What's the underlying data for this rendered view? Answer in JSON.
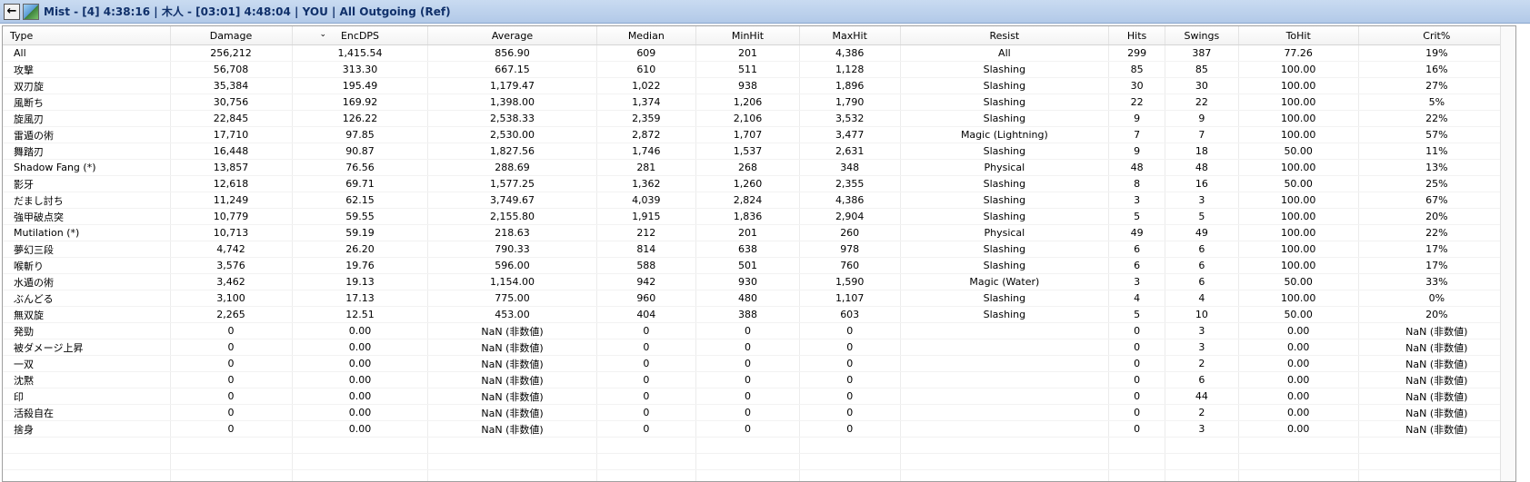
{
  "window": {
    "title": "Mist - [4] 4:38:16 | 木人 - [03:01] 4:48:04 | YOU | All Outgoing (Ref)",
    "back_icon": "←"
  },
  "table": {
    "columns": [
      "Type",
      "Damage",
      "EncDPS",
      "Average",
      "Median",
      "MinHit",
      "MaxHit",
      "Resist",
      "Hits",
      "Swings",
      "ToHit",
      "Crit%"
    ],
    "sorted_column": "EncDPS",
    "rows": [
      [
        "All",
        "256,212",
        "1,415.54",
        "856.90",
        "609",
        "201",
        "4,386",
        "All",
        "299",
        "387",
        "77.26",
        "19%"
      ],
      [
        "攻撃",
        "56,708",
        "313.30",
        "667.15",
        "610",
        "511",
        "1,128",
        "Slashing",
        "85",
        "85",
        "100.00",
        "16%"
      ],
      [
        "双刃旋",
        "35,384",
        "195.49",
        "1,179.47",
        "1,022",
        "938",
        "1,896",
        "Slashing",
        "30",
        "30",
        "100.00",
        "27%"
      ],
      [
        "風断ち",
        "30,756",
        "169.92",
        "1,398.00",
        "1,374",
        "1,206",
        "1,790",
        "Slashing",
        "22",
        "22",
        "100.00",
        "5%"
      ],
      [
        "旋風刃",
        "22,845",
        "126.22",
        "2,538.33",
        "2,359",
        "2,106",
        "3,532",
        "Slashing",
        "9",
        "9",
        "100.00",
        "22%"
      ],
      [
        "雷遁の術",
        "17,710",
        "97.85",
        "2,530.00",
        "2,872",
        "1,707",
        "3,477",
        "Magic (Lightning)",
        "7",
        "7",
        "100.00",
        "57%"
      ],
      [
        "舞踏刃",
        "16,448",
        "90.87",
        "1,827.56",
        "1,746",
        "1,537",
        "2,631",
        "Slashing",
        "9",
        "18",
        "50.00",
        "11%"
      ],
      [
        "Shadow Fang (*)",
        "13,857",
        "76.56",
        "288.69",
        "281",
        "268",
        "348",
        "Physical",
        "48",
        "48",
        "100.00",
        "13%"
      ],
      [
        "影牙",
        "12,618",
        "69.71",
        "1,577.25",
        "1,362",
        "1,260",
        "2,355",
        "Slashing",
        "8",
        "16",
        "50.00",
        "25%"
      ],
      [
        "だまし討ち",
        "11,249",
        "62.15",
        "3,749.67",
        "4,039",
        "2,824",
        "4,386",
        "Slashing",
        "3",
        "3",
        "100.00",
        "67%"
      ],
      [
        "強甲破点突",
        "10,779",
        "59.55",
        "2,155.80",
        "1,915",
        "1,836",
        "2,904",
        "Slashing",
        "5",
        "5",
        "100.00",
        "20%"
      ],
      [
        "Mutilation (*)",
        "10,713",
        "59.19",
        "218.63",
        "212",
        "201",
        "260",
        "Physical",
        "49",
        "49",
        "100.00",
        "22%"
      ],
      [
        "夢幻三段",
        "4,742",
        "26.20",
        "790.33",
        "814",
        "638",
        "978",
        "Slashing",
        "6",
        "6",
        "100.00",
        "17%"
      ],
      [
        "喉斬り",
        "3,576",
        "19.76",
        "596.00",
        "588",
        "501",
        "760",
        "Slashing",
        "6",
        "6",
        "100.00",
        "17%"
      ],
      [
        "水遁の術",
        "3,462",
        "19.13",
        "1,154.00",
        "942",
        "930",
        "1,590",
        "Magic (Water)",
        "3",
        "6",
        "50.00",
        "33%"
      ],
      [
        "ぶんどる",
        "3,100",
        "17.13",
        "775.00",
        "960",
        "480",
        "1,107",
        "Slashing",
        "4",
        "4",
        "100.00",
        "0%"
      ],
      [
        "無双旋",
        "2,265",
        "12.51",
        "453.00",
        "404",
        "388",
        "603",
        "Slashing",
        "5",
        "10",
        "50.00",
        "20%"
      ],
      [
        "発勁",
        "0",
        "0.00",
        "NaN (非数値)",
        "0",
        "0",
        "0",
        "",
        "0",
        "3",
        "0.00",
        "NaN (非数値)"
      ],
      [
        "被ダメージ上昇",
        "0",
        "0.00",
        "NaN (非数値)",
        "0",
        "0",
        "0",
        "",
        "0",
        "3",
        "0.00",
        "NaN (非数値)"
      ],
      [
        "一双",
        "0",
        "0.00",
        "NaN (非数値)",
        "0",
        "0",
        "0",
        "",
        "0",
        "2",
        "0.00",
        "NaN (非数値)"
      ],
      [
        "沈黙",
        "0",
        "0.00",
        "NaN (非数値)",
        "0",
        "0",
        "0",
        "",
        "0",
        "6",
        "0.00",
        "NaN (非数値)"
      ],
      [
        "印",
        "0",
        "0.00",
        "NaN (非数値)",
        "0",
        "0",
        "0",
        "",
        "0",
        "44",
        "0.00",
        "NaN (非数値)"
      ],
      [
        "活殺自在",
        "0",
        "0.00",
        "NaN (非数値)",
        "0",
        "0",
        "0",
        "",
        "0",
        "2",
        "0.00",
        "NaN (非数値)"
      ],
      [
        "捨身",
        "0",
        "0.00",
        "NaN (非数値)",
        "0",
        "0",
        "0",
        "",
        "0",
        "3",
        "0.00",
        "NaN (非数値)"
      ]
    ]
  }
}
